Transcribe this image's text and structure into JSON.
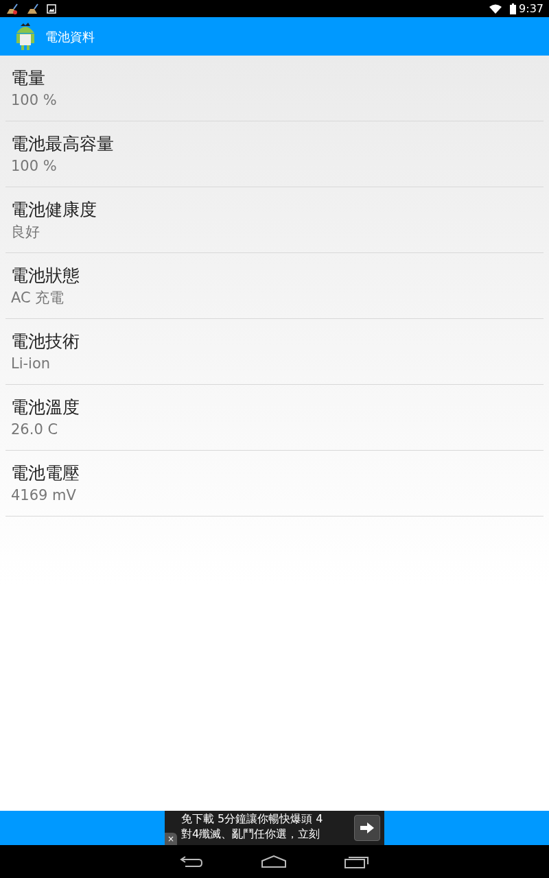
{
  "status_bar": {
    "time": "9:37"
  },
  "app_bar": {
    "title": "電池資料"
  },
  "items": [
    {
      "label": "電量",
      "value": "100 %"
    },
    {
      "label": "電池最高容量",
      "value": "100 %"
    },
    {
      "label": "電池健康度",
      "value": "良好"
    },
    {
      "label": "電池狀態",
      "value": "AC 充電"
    },
    {
      "label": "電池技術",
      "value": "Li-ion"
    },
    {
      "label": "電池溫度",
      "value": "26.0 C"
    },
    {
      "label": "電池電壓",
      "value": "4169 mV"
    }
  ],
  "ad": {
    "lines": [
      "免下載 5分鐘讓你暢快爆頭 4",
      "對4殲滅、亂鬥任你選，立刻"
    ],
    "close": "×"
  }
}
